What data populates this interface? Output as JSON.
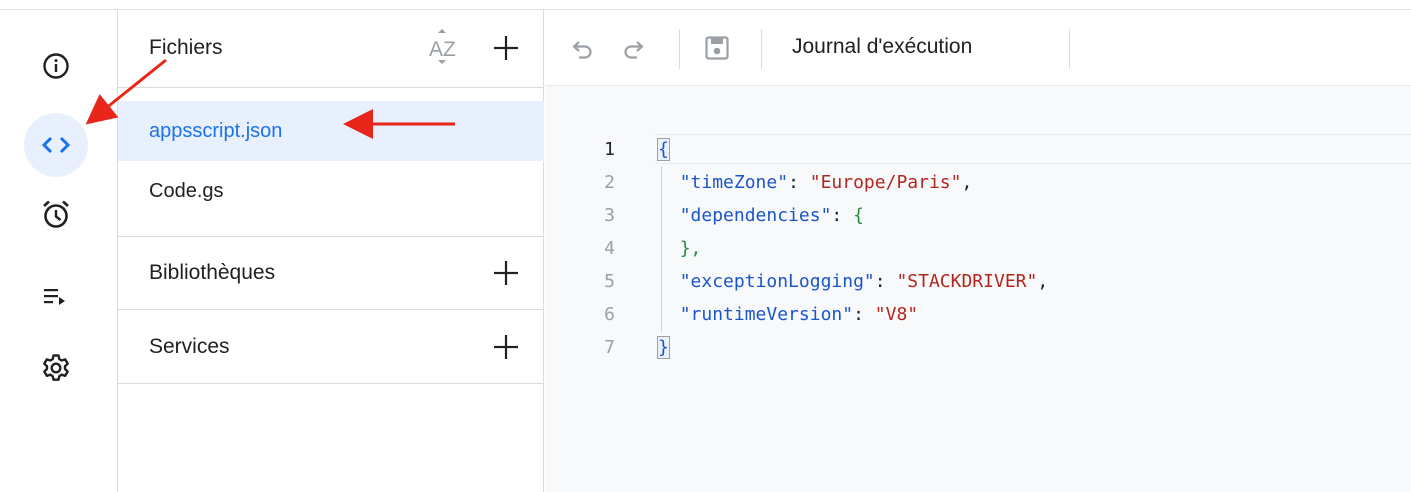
{
  "panel": {
    "files_title": "Fichiers",
    "libraries_title": "Bibliothèques",
    "services_title": "Services",
    "sort_icon_text": "AZ",
    "files": [
      {
        "name": "appsscript.json",
        "selected": true
      },
      {
        "name": "Code.gs",
        "selected": false
      }
    ]
  },
  "toolbar": {
    "log_label": "Journal d'exécution"
  },
  "rail": {
    "items": [
      {
        "icon": "info-icon"
      },
      {
        "icon": "code-icon",
        "active": true
      },
      {
        "icon": "alarm-clock-icon"
      },
      {
        "icon": "executions-icon"
      },
      {
        "icon": "gear-icon"
      }
    ]
  },
  "editor": {
    "line_numbers": [
      "1",
      "2",
      "3",
      "4",
      "5",
      "6",
      "7"
    ],
    "lines": [
      {
        "text": "{"
      },
      {
        "key": "\"timeZone\"",
        "value": "\"Europe/Paris\""
      },
      {
        "key": "\"dependencies\"",
        "open": "{"
      },
      {
        "close": "},"
      },
      {
        "key": "\"exceptionLogging\"",
        "value": "\"STACKDRIVER\""
      },
      {
        "key": "\"runtimeVersion\"",
        "value": "\"V8\""
      },
      {
        "text": "}"
      }
    ],
    "punct": {
      "colon": ": ",
      "comma": ","
    }
  },
  "colors": {
    "accent": "#1a73e8",
    "selected_bg": "#e8f0fe",
    "key": "#1a55c9",
    "string": "#b3261e",
    "arrow": "#e8261a"
  }
}
